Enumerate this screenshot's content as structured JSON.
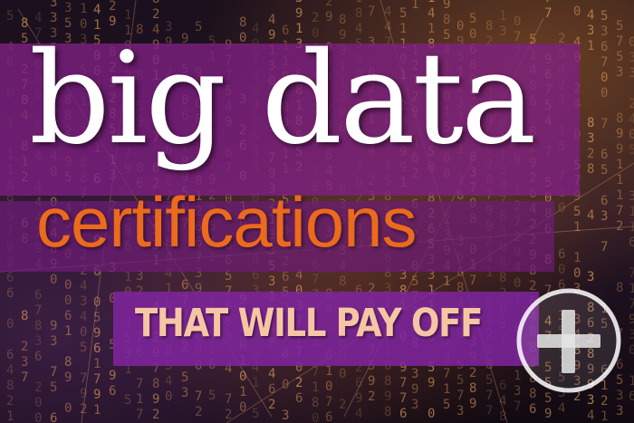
{
  "banner": {
    "headline": "big data",
    "subheadline": "certifications",
    "tagline": "THAT WILL PAY OFF",
    "action_icon": "plus-circle-icon"
  },
  "colors": {
    "headline": "#ffffff",
    "subheadline": "#ec6a1b",
    "tagline": "#f6c6a4",
    "band": "#802084",
    "tagline_band": "#8024a0",
    "digits": "#e8a35a"
  }
}
